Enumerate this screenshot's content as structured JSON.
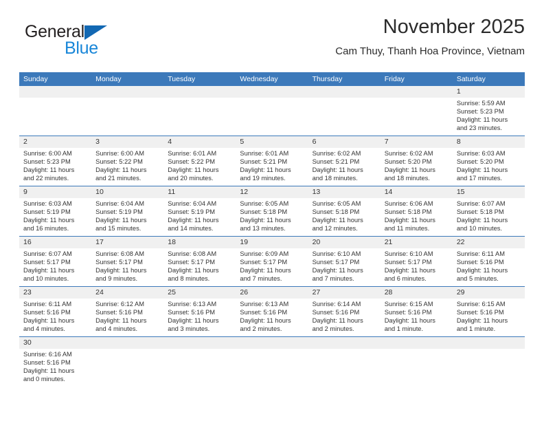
{
  "brand": {
    "name_top": "General",
    "name_bottom": "Blue",
    "color_dark": "#231f20",
    "color_blue": "#1886d8",
    "triangle_color": "#1268b3"
  },
  "header": {
    "title": "November 2025",
    "subtitle": "Cam Thuy, Thanh Hoa Province, Vietnam",
    "header_bg": "#3c79ba",
    "date_band_bg": "#f0f0f0"
  },
  "weekdays": [
    "Sunday",
    "Monday",
    "Tuesday",
    "Wednesday",
    "Thursday",
    "Friday",
    "Saturday"
  ],
  "weeks": [
    [
      {
        "day": "",
        "empty": true
      },
      {
        "day": "",
        "empty": true
      },
      {
        "day": "",
        "empty": true
      },
      {
        "day": "",
        "empty": true
      },
      {
        "day": "",
        "empty": true
      },
      {
        "day": "",
        "empty": true
      },
      {
        "day": "1",
        "sunrise": "Sunrise: 5:59 AM",
        "sunset": "Sunset: 5:23 PM",
        "daylight1": "Daylight: 11 hours",
        "daylight2": "and 23 minutes."
      }
    ],
    [
      {
        "day": "2",
        "sunrise": "Sunrise: 6:00 AM",
        "sunset": "Sunset: 5:23 PM",
        "daylight1": "Daylight: 11 hours",
        "daylight2": "and 22 minutes."
      },
      {
        "day": "3",
        "sunrise": "Sunrise: 6:00 AM",
        "sunset": "Sunset: 5:22 PM",
        "daylight1": "Daylight: 11 hours",
        "daylight2": "and 21 minutes."
      },
      {
        "day": "4",
        "sunrise": "Sunrise: 6:01 AM",
        "sunset": "Sunset: 5:22 PM",
        "daylight1": "Daylight: 11 hours",
        "daylight2": "and 20 minutes."
      },
      {
        "day": "5",
        "sunrise": "Sunrise: 6:01 AM",
        "sunset": "Sunset: 5:21 PM",
        "daylight1": "Daylight: 11 hours",
        "daylight2": "and 19 minutes."
      },
      {
        "day": "6",
        "sunrise": "Sunrise: 6:02 AM",
        "sunset": "Sunset: 5:21 PM",
        "daylight1": "Daylight: 11 hours",
        "daylight2": "and 18 minutes."
      },
      {
        "day": "7",
        "sunrise": "Sunrise: 6:02 AM",
        "sunset": "Sunset: 5:20 PM",
        "daylight1": "Daylight: 11 hours",
        "daylight2": "and 18 minutes."
      },
      {
        "day": "8",
        "sunrise": "Sunrise: 6:03 AM",
        "sunset": "Sunset: 5:20 PM",
        "daylight1": "Daylight: 11 hours",
        "daylight2": "and 17 minutes."
      }
    ],
    [
      {
        "day": "9",
        "sunrise": "Sunrise: 6:03 AM",
        "sunset": "Sunset: 5:19 PM",
        "daylight1": "Daylight: 11 hours",
        "daylight2": "and 16 minutes."
      },
      {
        "day": "10",
        "sunrise": "Sunrise: 6:04 AM",
        "sunset": "Sunset: 5:19 PM",
        "daylight1": "Daylight: 11 hours",
        "daylight2": "and 15 minutes."
      },
      {
        "day": "11",
        "sunrise": "Sunrise: 6:04 AM",
        "sunset": "Sunset: 5:19 PM",
        "daylight1": "Daylight: 11 hours",
        "daylight2": "and 14 minutes."
      },
      {
        "day": "12",
        "sunrise": "Sunrise: 6:05 AM",
        "sunset": "Sunset: 5:18 PM",
        "daylight1": "Daylight: 11 hours",
        "daylight2": "and 13 minutes."
      },
      {
        "day": "13",
        "sunrise": "Sunrise: 6:05 AM",
        "sunset": "Sunset: 5:18 PM",
        "daylight1": "Daylight: 11 hours",
        "daylight2": "and 12 minutes."
      },
      {
        "day": "14",
        "sunrise": "Sunrise: 6:06 AM",
        "sunset": "Sunset: 5:18 PM",
        "daylight1": "Daylight: 11 hours",
        "daylight2": "and 11 minutes."
      },
      {
        "day": "15",
        "sunrise": "Sunrise: 6:07 AM",
        "sunset": "Sunset: 5:18 PM",
        "daylight1": "Daylight: 11 hours",
        "daylight2": "and 10 minutes."
      }
    ],
    [
      {
        "day": "16",
        "sunrise": "Sunrise: 6:07 AM",
        "sunset": "Sunset: 5:17 PM",
        "daylight1": "Daylight: 11 hours",
        "daylight2": "and 10 minutes."
      },
      {
        "day": "17",
        "sunrise": "Sunrise: 6:08 AM",
        "sunset": "Sunset: 5:17 PM",
        "daylight1": "Daylight: 11 hours",
        "daylight2": "and 9 minutes."
      },
      {
        "day": "18",
        "sunrise": "Sunrise: 6:08 AM",
        "sunset": "Sunset: 5:17 PM",
        "daylight1": "Daylight: 11 hours",
        "daylight2": "and 8 minutes."
      },
      {
        "day": "19",
        "sunrise": "Sunrise: 6:09 AM",
        "sunset": "Sunset: 5:17 PM",
        "daylight1": "Daylight: 11 hours",
        "daylight2": "and 7 minutes."
      },
      {
        "day": "20",
        "sunrise": "Sunrise: 6:10 AM",
        "sunset": "Sunset: 5:17 PM",
        "daylight1": "Daylight: 11 hours",
        "daylight2": "and 7 minutes."
      },
      {
        "day": "21",
        "sunrise": "Sunrise: 6:10 AM",
        "sunset": "Sunset: 5:17 PM",
        "daylight1": "Daylight: 11 hours",
        "daylight2": "and 6 minutes."
      },
      {
        "day": "22",
        "sunrise": "Sunrise: 6:11 AM",
        "sunset": "Sunset: 5:16 PM",
        "daylight1": "Daylight: 11 hours",
        "daylight2": "and 5 minutes."
      }
    ],
    [
      {
        "day": "23",
        "sunrise": "Sunrise: 6:11 AM",
        "sunset": "Sunset: 5:16 PM",
        "daylight1": "Daylight: 11 hours",
        "daylight2": "and 4 minutes."
      },
      {
        "day": "24",
        "sunrise": "Sunrise: 6:12 AM",
        "sunset": "Sunset: 5:16 PM",
        "daylight1": "Daylight: 11 hours",
        "daylight2": "and 4 minutes."
      },
      {
        "day": "25",
        "sunrise": "Sunrise: 6:13 AM",
        "sunset": "Sunset: 5:16 PM",
        "daylight1": "Daylight: 11 hours",
        "daylight2": "and 3 minutes."
      },
      {
        "day": "26",
        "sunrise": "Sunrise: 6:13 AM",
        "sunset": "Sunset: 5:16 PM",
        "daylight1": "Daylight: 11 hours",
        "daylight2": "and 2 minutes."
      },
      {
        "day": "27",
        "sunrise": "Sunrise: 6:14 AM",
        "sunset": "Sunset: 5:16 PM",
        "daylight1": "Daylight: 11 hours",
        "daylight2": "and 2 minutes."
      },
      {
        "day": "28",
        "sunrise": "Sunrise: 6:15 AM",
        "sunset": "Sunset: 5:16 PM",
        "daylight1": "Daylight: 11 hours",
        "daylight2": "and 1 minute."
      },
      {
        "day": "29",
        "sunrise": "Sunrise: 6:15 AM",
        "sunset": "Sunset: 5:16 PM",
        "daylight1": "Daylight: 11 hours",
        "daylight2": "and 1 minute."
      }
    ],
    [
      {
        "day": "30",
        "sunrise": "Sunrise: 6:16 AM",
        "sunset": "Sunset: 5:16 PM",
        "daylight1": "Daylight: 11 hours",
        "daylight2": "and 0 minutes.",
        "full_band": true
      },
      {
        "day": "",
        "empty": true,
        "hide_band": true
      },
      {
        "day": "",
        "empty": true,
        "hide_band": true
      },
      {
        "day": "",
        "empty": true,
        "hide_band": true
      },
      {
        "day": "",
        "empty": true,
        "hide_band": true
      },
      {
        "day": "",
        "empty": true,
        "hide_band": true
      },
      {
        "day": "",
        "empty": true,
        "hide_band": true
      }
    ]
  ]
}
